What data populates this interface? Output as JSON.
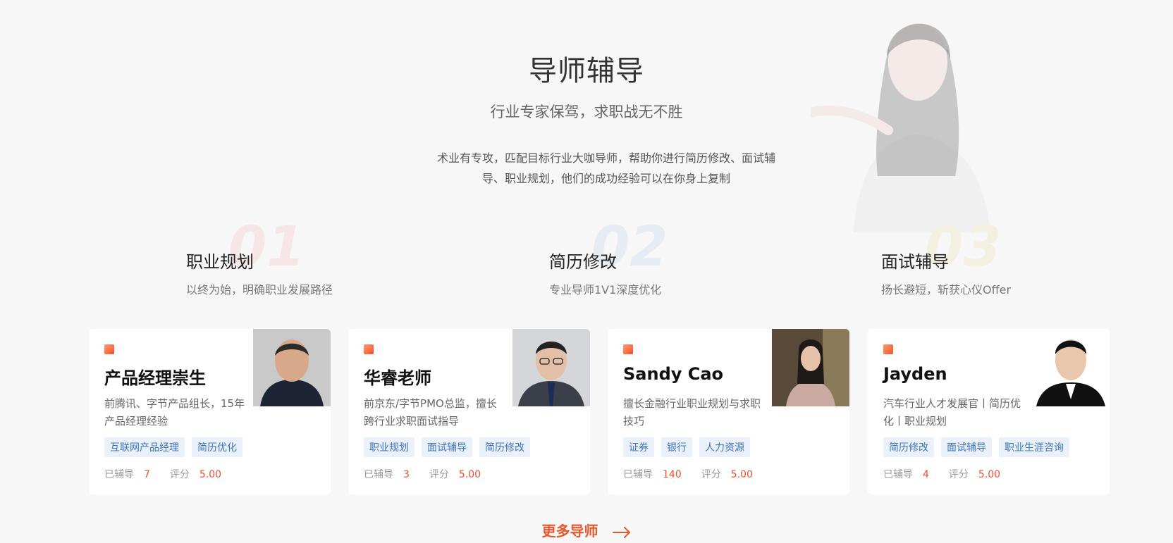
{
  "header": {
    "title": "导师辅导",
    "subtitle": "行业专家保驾，求职战无不胜",
    "desc_line1": "术业有专攻，匹配目标行业大咖导师，帮助你进行简历修改、面试辅",
    "desc_line2": "导、职业规划，他们的成功经验可以在你身上复制"
  },
  "features": [
    {
      "num": "01",
      "title": "职业规划",
      "subtitle": "以终为始，明确职业发展路径",
      "num_color": "#f7e6e6"
    },
    {
      "num": "02",
      "title": "简历修改",
      "subtitle": "专业导师1V1深度优化",
      "num_color": "#e6ecf3"
    },
    {
      "num": "03",
      "title": "面试辅导",
      "subtitle": "扬长避短，斩获心仪Offer",
      "num_color": "#f3f0e2"
    }
  ],
  "mentors": [
    {
      "name": "产品经理崇生",
      "bio": "前腾讯、字节产品组长，15年产品经理经验",
      "tags": [
        "互联网产品经理",
        "简历优化"
      ],
      "count_label": "已辅导",
      "count": "7",
      "rating_label": "评分",
      "rating": "5.00"
    },
    {
      "name": "华睿老师",
      "bio": "前京东/字节PMO总监，擅长跨行业求职面试指导",
      "tags": [
        "职业规划",
        "面试辅导",
        "简历修改"
      ],
      "count_label": "已辅导",
      "count": "3",
      "rating_label": "评分",
      "rating": "5.00"
    },
    {
      "name": "Sandy Cao",
      "bio": "擅长金融行业职业规划与求职技巧",
      "tags": [
        "证券",
        "银行",
        "人力资源"
      ],
      "count_label": "已辅导",
      "count": "140",
      "rating_label": "评分",
      "rating": "5.00"
    },
    {
      "name": "Jayden",
      "bio": "汽车行业人才发展官丨简历优化丨职业规划",
      "tags": [
        "简历修改",
        "面试辅导",
        "职业生涯咨询"
      ],
      "count_label": "已辅导",
      "count": "4",
      "rating_label": "评分",
      "rating": "5.00"
    }
  ],
  "more_label": "更多导师",
  "colors": {
    "accent": "#e8572a",
    "tag_bg": "#eaf1fb",
    "tag_text": "#3d74c2",
    "stat_value": "#f04e2f"
  }
}
